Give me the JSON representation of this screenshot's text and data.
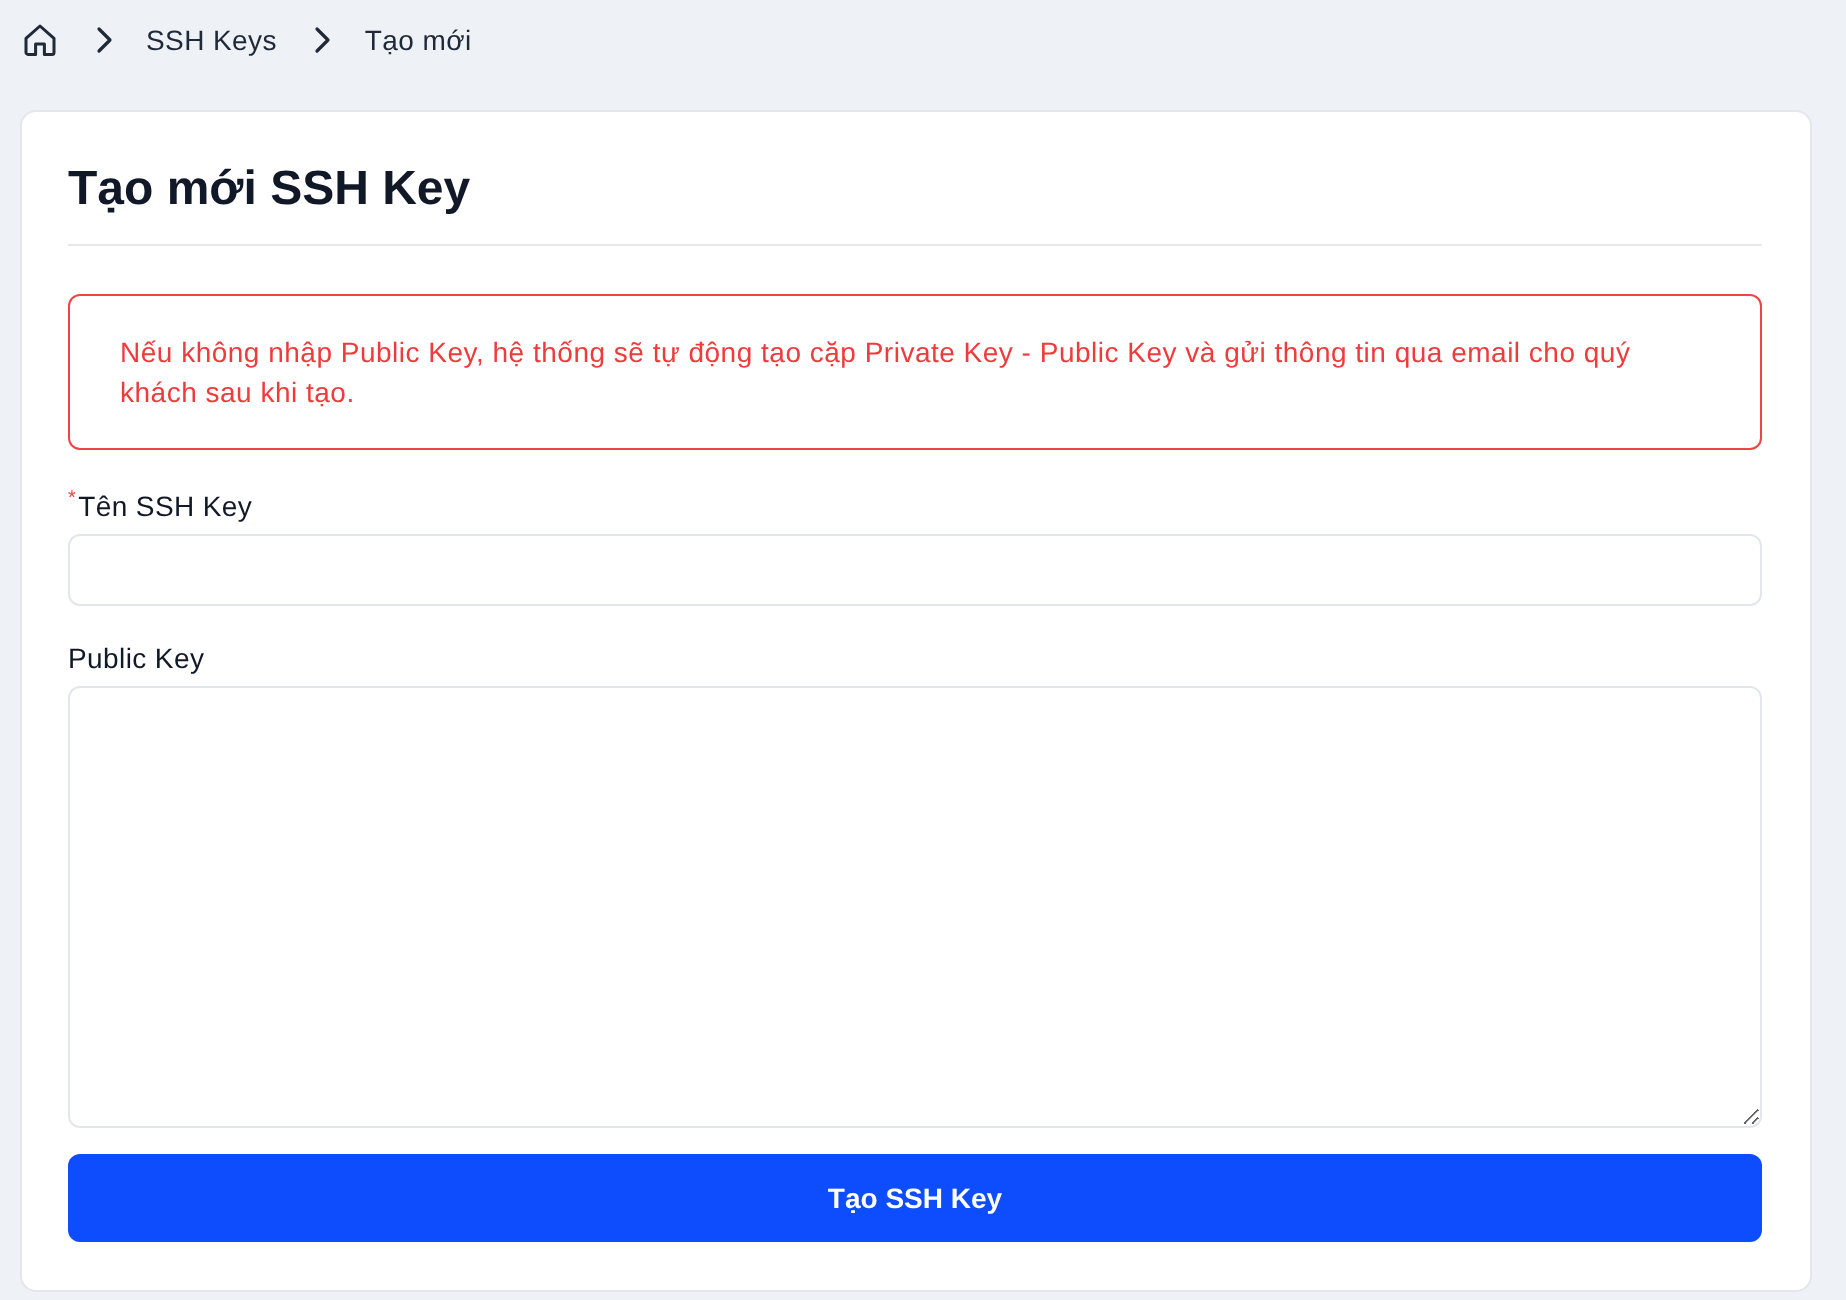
{
  "breadcrumb": [
    "SSH Keys",
    "Tạo mới"
  ],
  "card": {
    "title": "Tạo mới SSH Key",
    "notice": "Nếu không nhập Public Key, hệ thống sẽ tự động tạo cặp Private Key - Public Key và gửi thông tin qua email cho quý khách sau khi tạo.",
    "fields": [
      {
        "kind": "input",
        "label": "Tên SSH Key",
        "required_mark": "*"
      },
      {
        "kind": "textarea",
        "label": "Public Key"
      }
    ],
    "submit_button": "Tạo SSH Key"
  }
}
